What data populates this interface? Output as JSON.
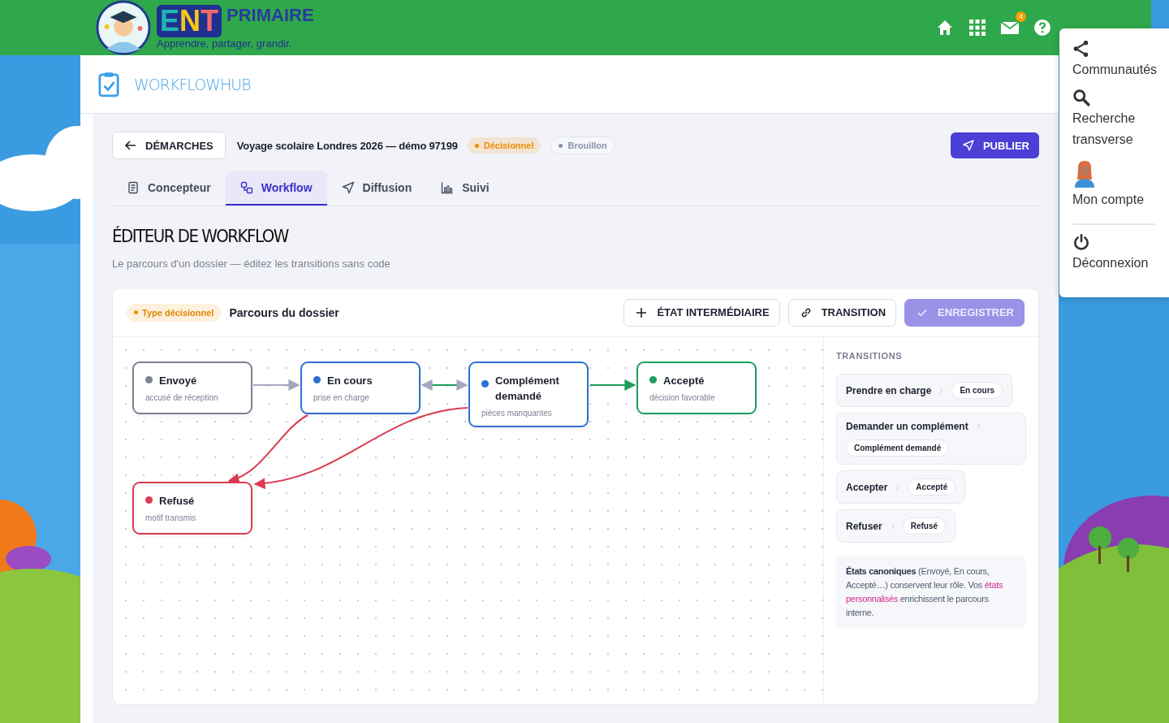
{
  "brand": {
    "letters": [
      {
        "text": "E",
        "color": "#1fb5b0"
      },
      {
        "text": "N",
        "color": "#f5c518"
      },
      {
        "text": "T",
        "color": "#f26b6b"
      }
    ],
    "name": "PRIMAIRE",
    "tagline": "Apprendre, partager, grandir."
  },
  "header_icons": {
    "mail_badge": "4"
  },
  "app": {
    "title": "WORKFLOWHUB"
  },
  "toolbar": {
    "back": "DÉMARCHES",
    "title": "Voyage scolaire Londres 2026 — démo 97199",
    "badges": [
      {
        "text": "Décisionnel",
        "color": "#f08c00"
      },
      {
        "text": "Brouillon",
        "color": "#8a90a6"
      }
    ],
    "publish": "PUBLIER"
  },
  "tabs": [
    {
      "label": "Concepteur",
      "selected": false
    },
    {
      "label": "Workflow",
      "selected": true
    },
    {
      "label": "Diffusion",
      "selected": false
    },
    {
      "label": "Suivi",
      "selected": false
    }
  ],
  "heading": "ÉDITEUR DE WORKFLOW",
  "subheading": "Le parcours d'un dossier — éditez les transitions sans code",
  "editor": {
    "type_badge": "Type décisionnel",
    "title": "Parcours du dossier",
    "buttons": [
      {
        "label": "ÉTAT INTERMÉDIAIRE",
        "kind": "outline",
        "disabled": false
      },
      {
        "label": "TRANSITION",
        "kind": "outline",
        "disabled": false
      },
      {
        "label": "ENREGISTRER",
        "kind": "primary",
        "disabled": true
      }
    ],
    "nodes": [
      {
        "title": "Envoyé",
        "subtitle": "accusé de réception",
        "color": "#7c8196"
      },
      {
        "title": "En cours",
        "subtitle": "prise en charge",
        "color": "#2f6fd0"
      },
      {
        "title": "Complément demandé",
        "subtitle": "pièces manquantes",
        "color": "#2f6fd0"
      },
      {
        "title": "Accepté",
        "subtitle": "décision favorable",
        "color": "#1f9d5c"
      },
      {
        "title": "Refusé",
        "subtitle": "motif transmis",
        "color": "#dc3b50"
      }
    ],
    "transitions_title": "TRANSITIONS",
    "transitions": [
      {
        "action": "Prendre en charge",
        "target": "En cours"
      },
      {
        "action": "Demander un complément",
        "target": "Complément demandé"
      },
      {
        "action": "Accepter",
        "target": "Accepté"
      },
      {
        "action": "Refuser",
        "target": "Refusé"
      }
    ],
    "note": [
      {
        "text": "États canoniques",
        "kind": "bold"
      },
      {
        "text": " (Envoyé, En cours, Accepté…) conservent leur rôle. Vos ",
        "kind": "plain"
      },
      {
        "text": "états personnalisés",
        "kind": "highlight"
      },
      {
        "text": " enrichissent le parcours interne.",
        "kind": "plain"
      }
    ]
  },
  "menu": [
    {
      "label": "Communautés"
    },
    {
      "label": "Recherche transverse"
    },
    {
      "label": "Mon compte"
    },
    {
      "label": "Déconnexion"
    }
  ]
}
